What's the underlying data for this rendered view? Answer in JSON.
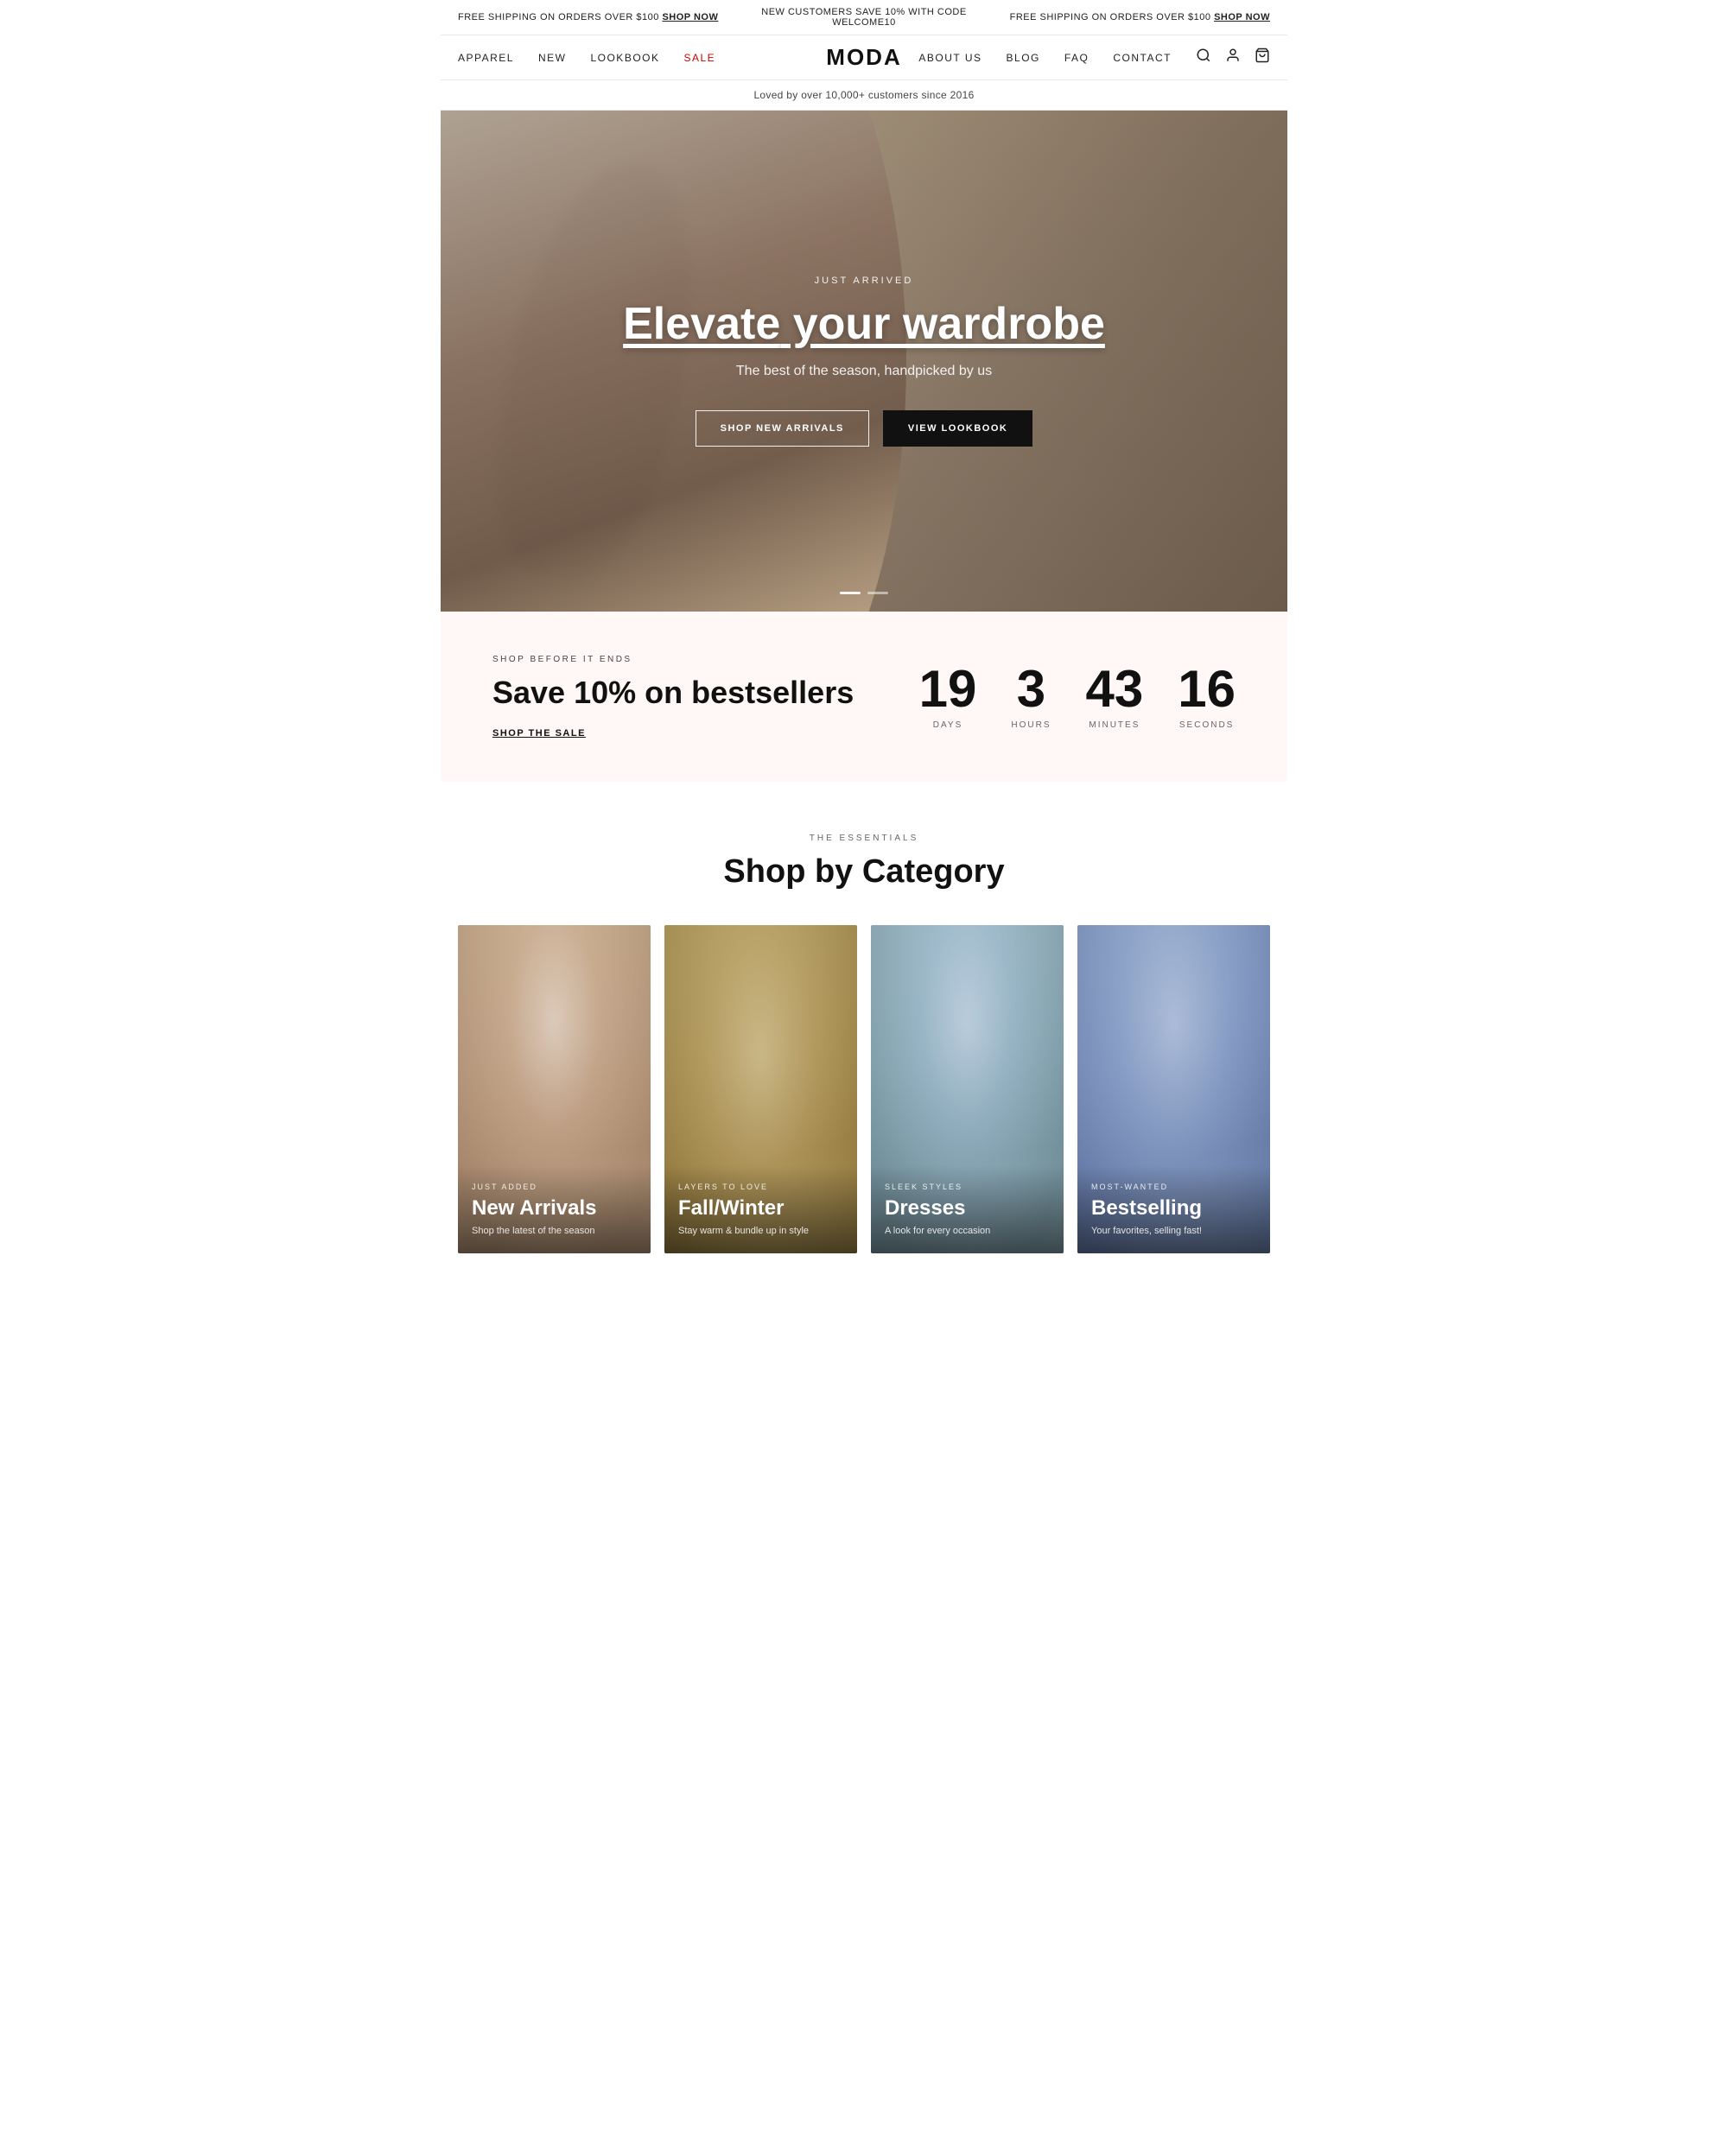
{
  "announcement": {
    "left": "FREE SHIPPING ON ORDERS OVER $100",
    "left_cta": "SHOP NOW",
    "center": "NEW CUSTOMERS SAVE 10% WITH CODE WELCOME10",
    "right": "FREE SHIPPING ON ORDERS OVER $100",
    "right_cta": "SHOP NOW"
  },
  "nav": {
    "logo": "MODA",
    "left_links": [
      {
        "label": "APPAREL",
        "href": "#"
      },
      {
        "label": "NEW",
        "href": "#"
      },
      {
        "label": "LOOKBOOK",
        "href": "#"
      },
      {
        "label": "SALE",
        "href": "#",
        "class": "sale"
      }
    ],
    "right_links": [
      {
        "label": "ABOUT US",
        "href": "#"
      },
      {
        "label": "BLOG",
        "href": "#"
      },
      {
        "label": "FAQ",
        "href": "#"
      },
      {
        "label": "CONTACT",
        "href": "#"
      }
    ],
    "icons": [
      "search",
      "account",
      "cart"
    ]
  },
  "sub_banner": "Loved by over 10,000+ customers since 2016",
  "hero": {
    "eyebrow": "JUST ARRIVED",
    "title_start": "Elevate",
    "title_end": " your wardrobe",
    "subtitle": "The best of the season, handpicked by us",
    "btn_primary": "SHOP NEW ARRIVALS",
    "btn_secondary": "VIEW LOOKBOOK"
  },
  "sale": {
    "eyebrow": "SHOP BEFORE IT ENDS",
    "title": "Save 10% on bestsellers",
    "cta": "SHOP THE SALE",
    "timer": {
      "days": "19",
      "hours": "3",
      "minutes": "43",
      "seconds": "16",
      "days_label": "DAYS",
      "hours_label": "HOURS",
      "minutes_label": "MINUTES",
      "seconds_label": "SECONDS"
    }
  },
  "categories": {
    "eyebrow": "THE ESSENTIALS",
    "title": "Shop by Category",
    "items": [
      {
        "eyebrow": "JUST ADDED",
        "name": "New Arrivals",
        "desc": "Shop the latest of the season"
      },
      {
        "eyebrow": "LAYERS TO LOVE",
        "name": "Fall/Winter",
        "desc": "Stay warm & bundle up in style"
      },
      {
        "eyebrow": "SLEEK STYLES",
        "name": "Dresses",
        "desc": "A look for every occasion"
      },
      {
        "eyebrow": "MOST-WANTED",
        "name": "Bestselling",
        "desc": "Your favorites, selling fast!"
      }
    ]
  }
}
